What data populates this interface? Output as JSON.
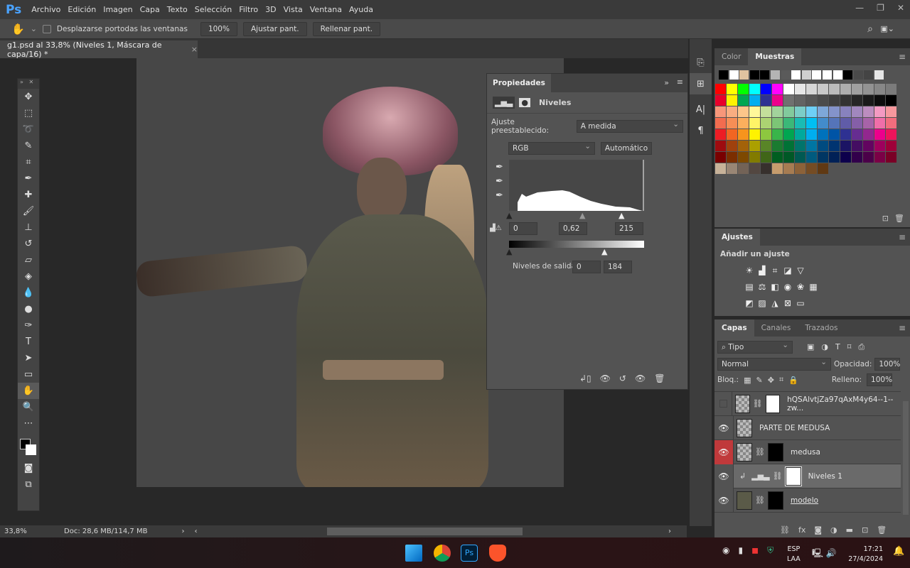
{
  "app": {
    "logo": "Ps",
    "menu": [
      "Archivo",
      "Edición",
      "Imagen",
      "Capa",
      "Texto",
      "Selección",
      "Filtro",
      "3D",
      "Vista",
      "Ventana",
      "Ayuda"
    ]
  },
  "options": {
    "scroll_all_label": "Desplazarse portodas las ventanas",
    "zoom100": "100%",
    "fit": "Ajustar pant.",
    "fill": "Rellenar pant."
  },
  "document": {
    "tab_title": "g1.psd al 33,8% (Niveles 1, Máscara de capa/16) *",
    "close": "×"
  },
  "properties": {
    "tab": "Propiedades",
    "title": "Niveles",
    "preset_label": "Ajuste preestablecido:",
    "preset_value": "A medida",
    "channel": "RGB",
    "auto": "Automático",
    "input_black": "0",
    "input_gamma": "0,62",
    "input_white": "215",
    "output_label": "Niveles de salida:",
    "output_black": "0",
    "output_white": "184"
  },
  "swatches": {
    "tabs": [
      "Color",
      "Muestras"
    ],
    "recent": [
      "#000000",
      "#ffffff",
      "#e0c3a0",
      "#000000",
      "#000000",
      "#b4b4b4",
      "#5a5a5a",
      "#ffffff",
      "#cfcfcf",
      "#ffffff",
      "#ffffff",
      "#ffffff",
      "#000000",
      "#4a4a4a",
      "#444444",
      "#e6e6e6"
    ],
    "grid": [
      [
        "#ff0000",
        "#ffff00",
        "#00ff00",
        "#00ffff",
        "#0000ff",
        "#ff00ff",
        "#ffffff",
        "#e6e6e6",
        "#d6d6d6",
        "#c8c8c8",
        "#bababa",
        "#adadad",
        "#a0a0a0",
        "#939393",
        "#878787",
        "#7b7b7b"
      ],
      [
        "#e8002b",
        "#fff200",
        "#00a651",
        "#00aeef",
        "#2e3192",
        "#ec008c",
        "#707070",
        "#636363",
        "#575757",
        "#4b4b4b",
        "#3f3f3f",
        "#333333",
        "#262626",
        "#1a1a1a",
        "#0d0d0d",
        "#000000"
      ],
      [
        "#f7977a",
        "#f9ad81",
        "#fdc68a",
        "#fff79a",
        "#c4df9b",
        "#a2d39c",
        "#82ca9d",
        "#7bcdc8",
        "#6ecff6",
        "#7ea7d8",
        "#8493ca",
        "#8882be",
        "#a187be",
        "#bc8dbf",
        "#f49ac2",
        "#f6989d"
      ],
      [
        "#f26c4f",
        "#f68e56",
        "#fbaf5d",
        "#fff467",
        "#acd372",
        "#7cc576",
        "#3bb878",
        "#1abbb4",
        "#00bff3",
        "#438ccb",
        "#5574b9",
        "#605ca8",
        "#855fa8",
        "#a763a8",
        "#f06ea9",
        "#f26d7d"
      ],
      [
        "#ed1c24",
        "#f26522",
        "#f7941d",
        "#fff200",
        "#8dc73f",
        "#39b54a",
        "#00a651",
        "#00a99d",
        "#00aeef",
        "#0072bc",
        "#0054a6",
        "#2e3192",
        "#662d91",
        "#92278f",
        "#ec008c",
        "#ed145b"
      ],
      [
        "#9e0b0f",
        "#a0410d",
        "#a36209",
        "#aba000",
        "#598527",
        "#1a7b30",
        "#007236",
        "#00746b",
        "#0076a3",
        "#004b80",
        "#003471",
        "#1b1464",
        "#440e62",
        "#630460",
        "#9e005d",
        "#9e0039"
      ],
      [
        "#790000",
        "#7b2e00",
        "#7d4900",
        "#827b00",
        "#406618",
        "#005e20",
        "#005826",
        "#005952",
        "#005b7f",
        "#003663",
        "#002157",
        "#0d004c",
        "#32004b",
        "#4b0049",
        "#7b0046",
        "#7a0026"
      ],
      [
        "#c7b299",
        "#998675",
        "#736357",
        "#534741",
        "#37302d",
        "#c69c6d",
        "#a67c52",
        "#8c6239",
        "#754c24",
        "#603913"
      ]
    ]
  },
  "adjustments": {
    "tab": "Ajustes",
    "heading": "Añadir un ajuste"
  },
  "layers": {
    "tabs": [
      "Capas",
      "Canales",
      "Trazados"
    ],
    "filter": "Tipo",
    "blend": "Normal",
    "opacity_label": "Opacidad:",
    "opacity": "100%",
    "lock_label": "Bloq.:",
    "fill_label": "Relleno:",
    "fill": "100%",
    "items": [
      {
        "name": "hQSAlvtjZa97qAxM4y64--1--zw...",
        "visible": false
      },
      {
        "name": "PARTE DE MEDUSA",
        "visible": true
      },
      {
        "name": "medusa",
        "visible": true
      },
      {
        "name": "Niveles 1",
        "visible": true,
        "selected": true
      },
      {
        "name": "modelo",
        "visible": true
      }
    ]
  },
  "status": {
    "zoom": "33,8%",
    "doc": "Doc: 28,6 MB/114,7 MB"
  },
  "taskbar": {
    "lang1": "ESP",
    "lang2": "LAA",
    "time": "17:21",
    "date": "27/4/2024"
  }
}
